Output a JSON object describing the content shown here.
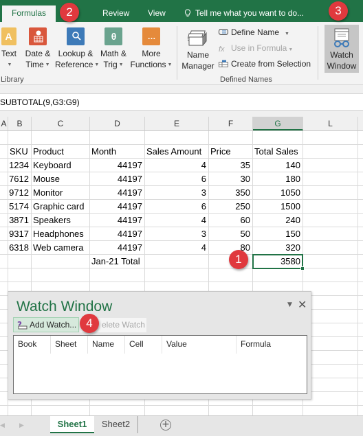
{
  "ribbon_tabs": {
    "formulas": "Formulas",
    "review": "Review",
    "view": "View"
  },
  "tell_me": "Tell me what you want to do...",
  "function_library": {
    "group_label": "Library",
    "buttons": [
      {
        "line1": "Text",
        "line2": "",
        "icon": "A",
        "color": "#f0c060"
      },
      {
        "line1": "Date &",
        "line2": "Time",
        "icon": "calendar",
        "color": "#d9573c"
      },
      {
        "line1": "Lookup &",
        "line2": "Reference",
        "icon": "magnifier",
        "color": "#3d7ab8"
      },
      {
        "line1": "Math &",
        "line2": "Trig",
        "icon": "θ",
        "color": "#6aa38e"
      },
      {
        "line1": "More",
        "line2": "Functions",
        "icon": "…",
        "color": "#e58a3b"
      }
    ]
  },
  "defined_names": {
    "group_label": "Defined Names",
    "name_manager": {
      "line1": "Name",
      "line2": "Manager"
    },
    "define_name": "Define Name",
    "use_in_formula": "Use in Formula",
    "create_from_selection": "Create from Selection"
  },
  "watch_window_button": {
    "line1": "Watch",
    "line2": "Window"
  },
  "formula_bar": {
    "value": "SUBTOTAL(9,G3:G9)"
  },
  "columns": [
    "A",
    "B",
    "C",
    "D",
    "E",
    "F",
    "G",
    "L"
  ],
  "selected_column": "G",
  "table": {
    "headers": [
      "SKU",
      "Product",
      "Month",
      "Sales Amount",
      "Price",
      "Total Sales"
    ],
    "rows": [
      [
        "1234",
        "Keyboard",
        "44197",
        "4",
        "35",
        "140"
      ],
      [
        "7612",
        "Mouse",
        "44197",
        "6",
        "30",
        "180"
      ],
      [
        "9712",
        "Monitor",
        "44197",
        "3",
        "350",
        "1050"
      ],
      [
        "5174",
        "Graphic card",
        "44197",
        "6",
        "250",
        "1500"
      ],
      [
        "3871",
        "Speakers",
        "44197",
        "4",
        "60",
        "240"
      ],
      [
        "9317",
        "Headphones",
        "44197",
        "3",
        "50",
        "150"
      ],
      [
        "6318",
        "Web camera",
        "44197",
        "4",
        "80",
        "320"
      ]
    ],
    "total_label": "Jan-21 Total",
    "total_value": "3580"
  },
  "badges": [
    "1",
    "2",
    "3",
    "4"
  ],
  "watch_window": {
    "title": "Watch Window",
    "add_watch": "Add Watch...",
    "delete_watch": "Delete Watch",
    "delete_watch_visible": "elete Watch",
    "columns": [
      "Book",
      "Sheet",
      "Name",
      "Cell",
      "Value",
      "Formula"
    ]
  },
  "sheets": {
    "tabs": [
      "Sheet1",
      "Sheet2"
    ],
    "active": "Sheet1",
    "add": "+"
  },
  "colors": {
    "excel_green": "#217346",
    "badge_red": "#e0393e"
  }
}
